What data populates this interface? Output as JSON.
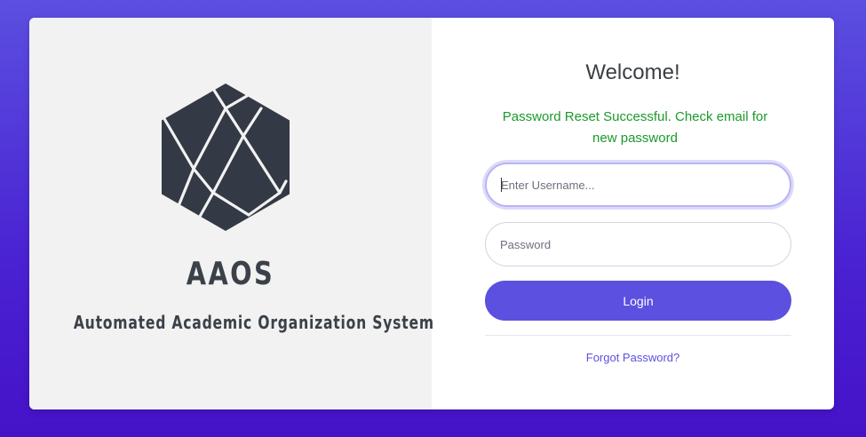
{
  "brand": {
    "name": "AAOS",
    "tagline": "Automated Academic Organization System",
    "logo_icon": "hexagon-logo-icon"
  },
  "login": {
    "heading": "Welcome!",
    "alert": "Password Reset Successful. Check email for new password",
    "username_placeholder": "Enter Username...",
    "password_placeholder": "Password",
    "submit_label": "Login",
    "forgot_label": "Forgot Password?"
  },
  "colors": {
    "accent": "#5b50df",
    "success": "#1b9a2a",
    "logo": "#343a45"
  }
}
